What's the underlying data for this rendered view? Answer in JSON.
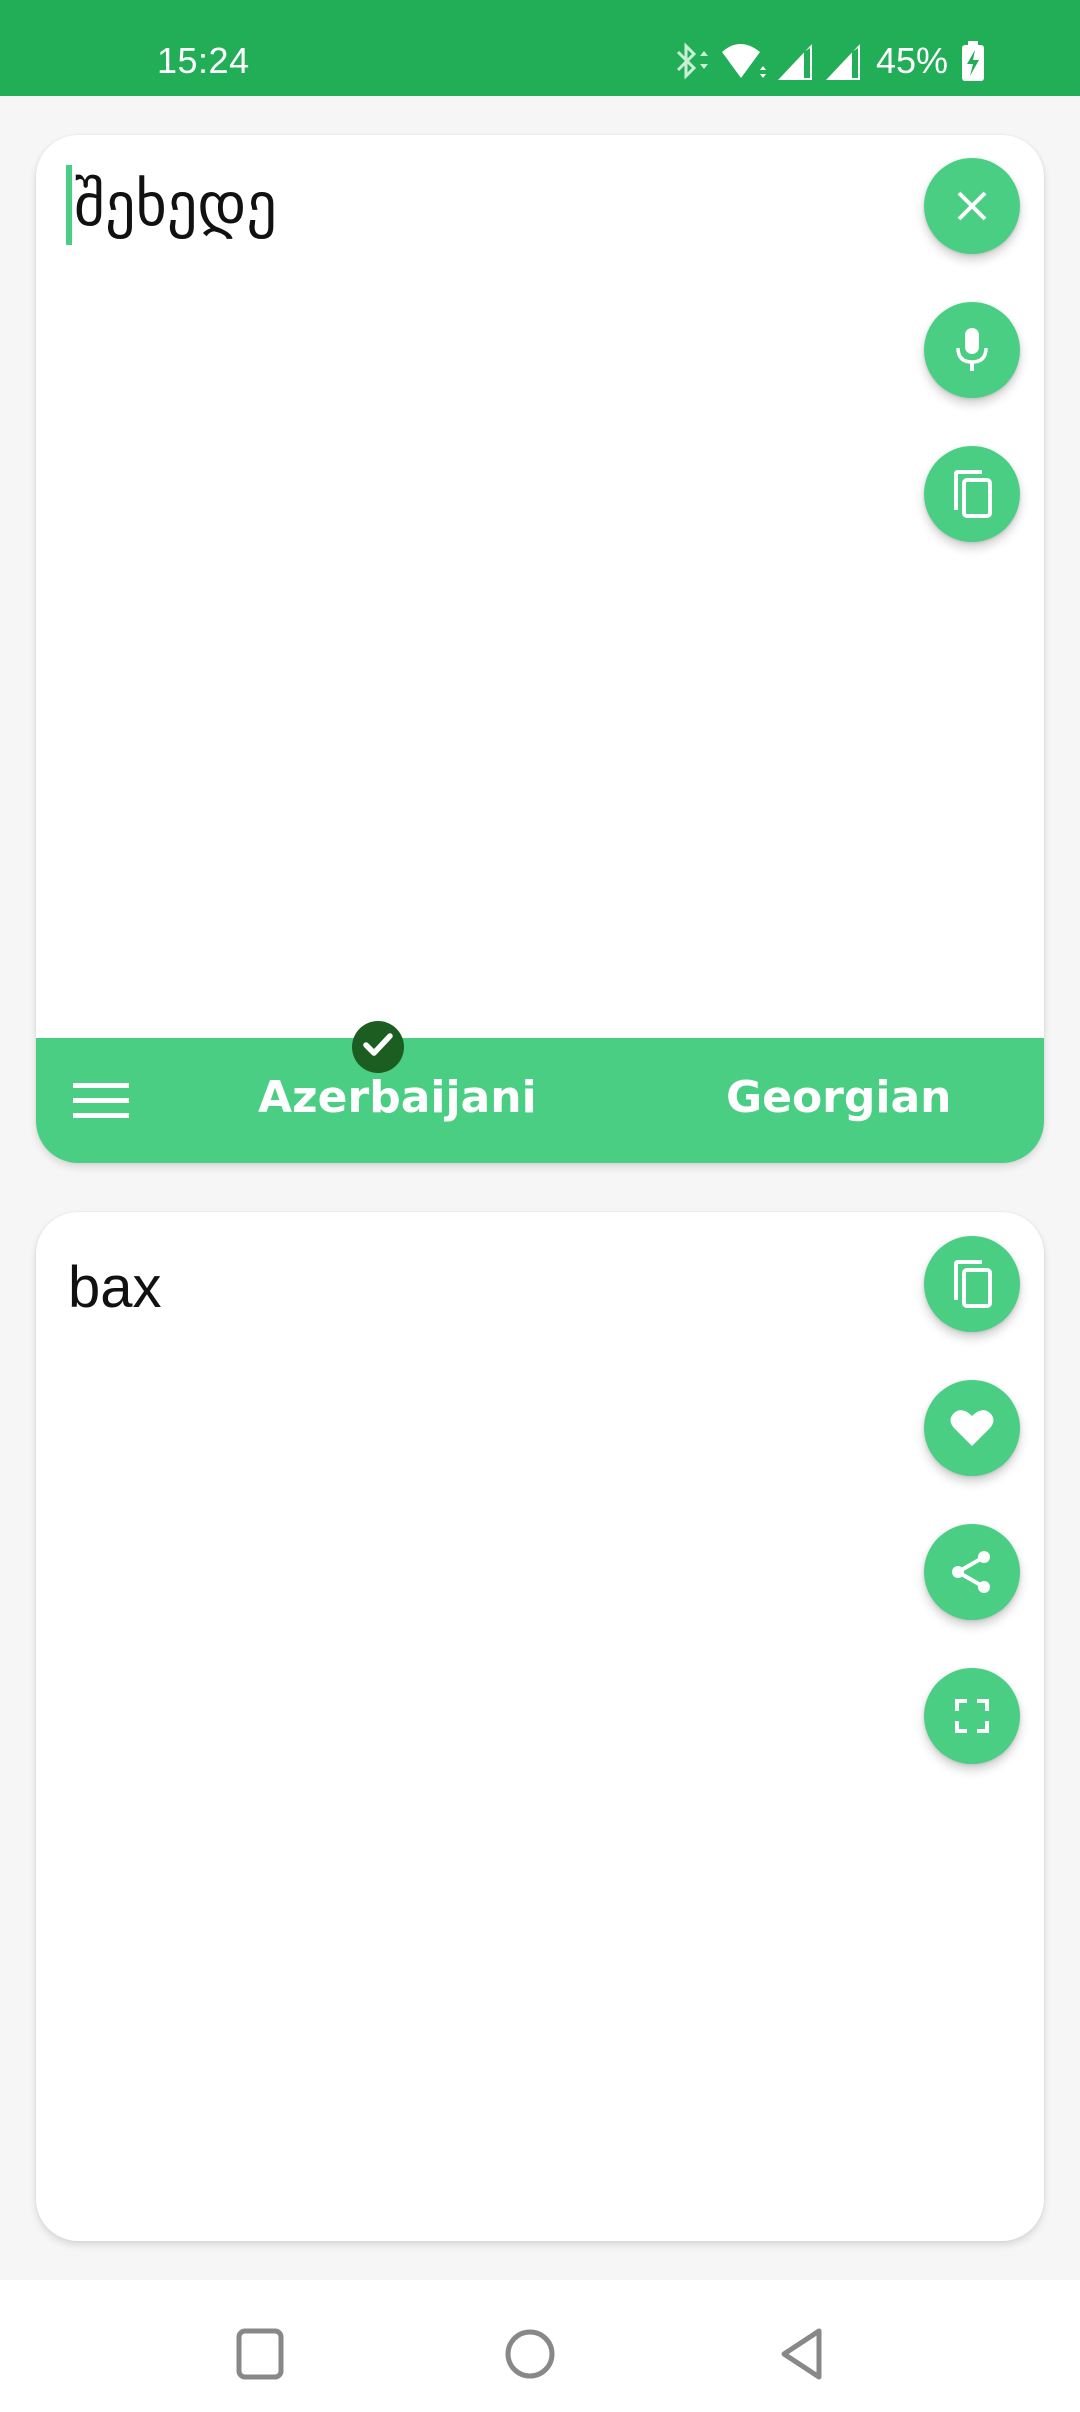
{
  "status_bar": {
    "time": "15:24",
    "battery_percent": "45%",
    "icons": [
      "bluetooth-icon",
      "wifi-icon",
      "signal-icon",
      "signal-icon",
      "battery-charging-icon"
    ]
  },
  "source_panel": {
    "text": "შეხედე",
    "buttons": [
      {
        "name": "clear-button",
        "icon": "close-icon"
      },
      {
        "name": "voice-input-button",
        "icon": "microphone-icon"
      },
      {
        "name": "paste-button",
        "icon": "copy-icon"
      }
    ]
  },
  "language_bar": {
    "menu_icon": "hamburger-menu-icon",
    "source_language": "Azerbaijani",
    "target_language": "Georgian",
    "selected_indicator_icon": "check-icon"
  },
  "target_panel": {
    "text": "bax",
    "buttons": [
      {
        "name": "copy-translation-button",
        "icon": "copy-icon"
      },
      {
        "name": "favorite-button",
        "icon": "heart-icon"
      },
      {
        "name": "share-button",
        "icon": "share-icon"
      },
      {
        "name": "fullscreen-button",
        "icon": "fullscreen-icon"
      }
    ]
  },
  "nav_bar": {
    "buttons": [
      "recents-button",
      "home-button",
      "back-button"
    ]
  },
  "colors": {
    "status_bar": "#22ae57",
    "accent": "#4ace84",
    "check_badge": "#1c5e22",
    "background": "#f6f6f6"
  }
}
